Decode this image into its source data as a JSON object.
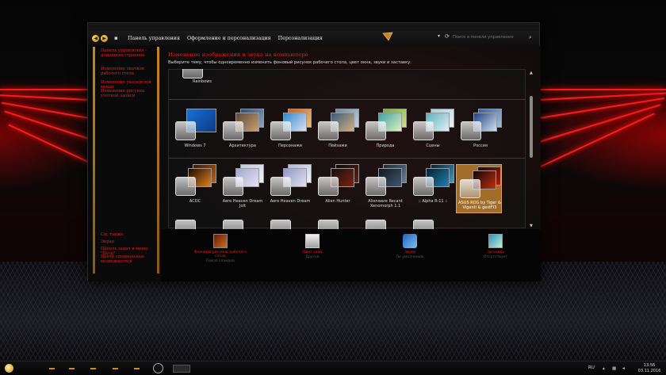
{
  "window": {
    "nav": {
      "crumb_control_panel": "Панель управления",
      "crumb_appearance": "Оформление и персонализация",
      "crumb_personalization": "Персонализация"
    },
    "search": {
      "placeholder": "Поиск в панели управления"
    }
  },
  "sidebar": {
    "tasks": [
      {
        "label": "Панель управления - домашняя страница"
      },
      {
        "label": "Изменение значков рабочего стола"
      },
      {
        "label": "Изменение указателей мыши"
      },
      {
        "label": "Изменение рисунка учетной записи"
      }
    ],
    "see_also": [
      {
        "label": "См. также"
      },
      {
        "label": "Экран"
      },
      {
        "label": "Панель задач и меню \"Пуск\""
      },
      {
        "label": "Центр специальных возможностей"
      }
    ]
  },
  "main": {
    "title": "Изменение изображения и звука на компьютере",
    "description": "Выберите тему, чтобы одновременно изменить фоновый рисунок рабочего стола, цвет окна, звуки и заставку.",
    "partial_theme": {
      "label": "Rainbows"
    },
    "themes_row1": [
      {
        "label": "Windows 7"
      },
      {
        "label": "Архитектура"
      },
      {
        "label": "Персонажи"
      },
      {
        "label": "Пейзажи"
      },
      {
        "label": "Природа"
      },
      {
        "label": "Сцены"
      },
      {
        "label": "Россия"
      }
    ],
    "themes_row2": [
      {
        "label": "ACDC"
      },
      {
        "label": "Aero Heaven Dream Jolt"
      },
      {
        "label": "Aero Heaven Dream"
      },
      {
        "label": "Alien Hunter"
      },
      {
        "label": "Alienware Recant Xenomorph 1.1"
      },
      {
        "label": ":: Alpha R-11 ::"
      },
      {
        "label": "ASUS ROG by Tiger & Vigenti & gestFI3"
      }
    ],
    "selected_theme_index": 6
  },
  "bottom_bar": {
    "items": [
      {
        "label": "Фоновый рисунок рабочего стола",
        "sub": "Показ слайдов"
      },
      {
        "label": "Цвет окна",
        "sub": "Другой"
      },
      {
        "label": "Звуки",
        "sub": "По умолчанию"
      },
      {
        "label": "Заставка",
        "sub": "Отсутствует"
      }
    ]
  },
  "taskbar": {
    "language": "RU",
    "time": "13:56",
    "date": "03.11.2016"
  },
  "colors": {
    "accent_red": "#e02020",
    "accent_gold": "#c9851e",
    "selected_bg": "#d28c32"
  }
}
